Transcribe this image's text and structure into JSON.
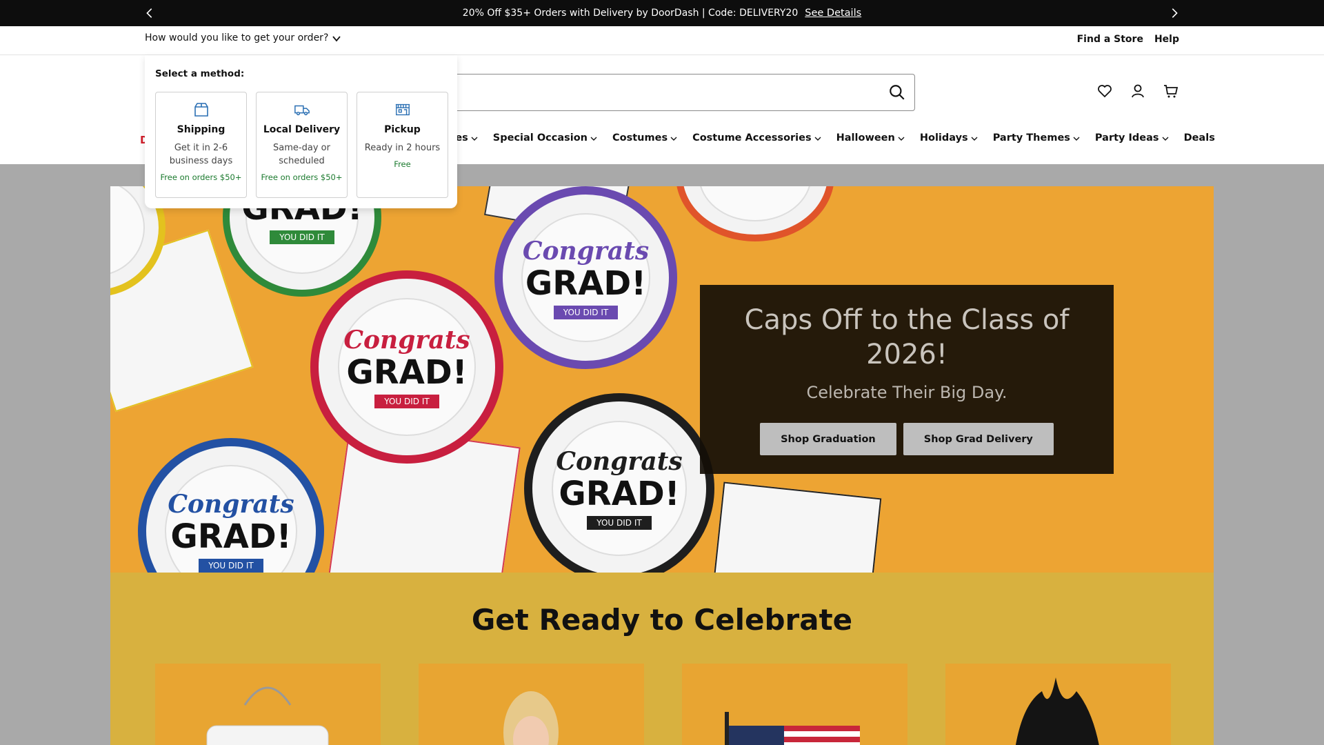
{
  "promo": {
    "text": "20% Off $35+ Orders with Delivery by DoorDash | Code: DELIVERY20",
    "link": "See Details"
  },
  "utility": {
    "order_question": "How would you like to get your order?",
    "find_store": "Find a Store",
    "help": "Help"
  },
  "search": {
    "placeholder": ""
  },
  "logo_fragment": "D",
  "nav": [
    {
      "label": "plies"
    },
    {
      "label": "Special Occasion"
    },
    {
      "label": "Costumes"
    },
    {
      "label": "Costume Accessories"
    },
    {
      "label": "Halloween"
    },
    {
      "label": "Holidays"
    },
    {
      "label": "Party Themes"
    },
    {
      "label": "Party Ideas"
    },
    {
      "label": "Deals"
    }
  ],
  "dropdown": {
    "title": "Select a method:",
    "methods": [
      {
        "name": "Shipping",
        "desc": "Get it in 2-6 business days",
        "note": "Free on orders $50+",
        "icon": "box-icon"
      },
      {
        "name": "Local Delivery",
        "desc": "Same-day or scheduled",
        "note": "Free on orders $50+",
        "icon": "truck-icon"
      },
      {
        "name": "Pickup",
        "desc": "Ready in 2 hours",
        "note": "Free",
        "icon": "store-icon"
      }
    ]
  },
  "hero": {
    "title": "Caps Off to the Class of 2026!",
    "subtitle": "Celebrate Their Big Day.",
    "btn1": "Shop Graduation",
    "btn2": "Shop Grad Delivery",
    "plate_congrats": "Congrats",
    "plate_grad": "GRAD!",
    "plate_youdidit": "YOU DID IT"
  },
  "celebrate": {
    "title": "Get Ready to Celebrate"
  },
  "colors": {
    "promo_bg": "#0d0d0d",
    "hero_bg": "#eda433",
    "accent_green": "#1b7a2e",
    "brand_red": "#d21e2b"
  }
}
